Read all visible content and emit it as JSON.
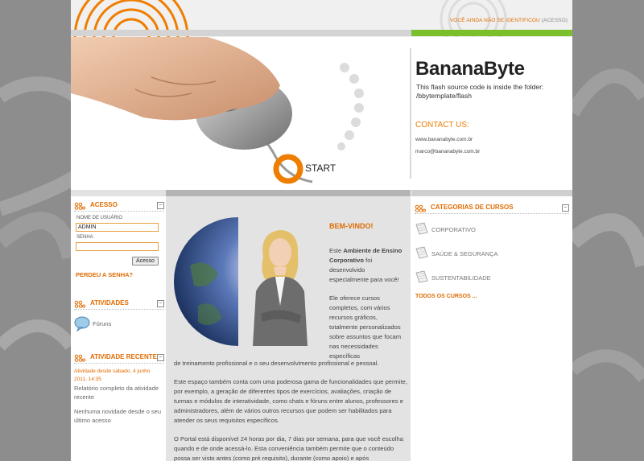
{
  "header": {
    "login_status_text": "VOCÊ AINDA NÃO SE IDENTIFICOU",
    "login_link": "(ACESSO)"
  },
  "banner": {
    "brand": "BananaByte",
    "note_line1": "This flash source code is inside the folder:",
    "note_line2": "/bbytemplate/flash",
    "contact_title": "CONTACT US:",
    "contact_site": "www.bananabyte.com.br",
    "contact_email": "marco@bananabyte.com.br",
    "start_label": "START"
  },
  "access_block": {
    "title": "ACESSO",
    "username_label": "NOME DE USUÁRIO",
    "username_value": "ADMIN",
    "password_label": "SENHA",
    "password_value": "",
    "submit_label": "Acesso",
    "forgot_link": "PERDEU A SENHA?"
  },
  "activities_block": {
    "title": "ATIVIDADES",
    "forums_label": "Fóruns"
  },
  "recent_block": {
    "title": "ATIVIDADE RECENTE",
    "since_text": "Atividade desde sábado, 4 junho 2011, 14:35",
    "full_report_link": "Relatório completo da atividade recente",
    "no_news": "Nenhuma novidade desde o seu último acesso"
  },
  "welcome": {
    "title": "BEM-VINDO!",
    "p1_prefix": "Este ",
    "p1_bold": "Ambiente de Ensino Corporativo",
    "p1_suffix": " foi desenvolvido especialmente para você!",
    "p2_col": "Ele oferece cursos completos, com vários recursos gráficos, totalmente personalizados sobre assuntos que focam nas necessidades específicas",
    "p2_full": "de treinamento profissional e o seu desenvolvimento profissional e pessoal.",
    "p3": "Este espaço também conta com uma poderosa gama de funcionalidades que permite, por exemplo, a geração de diferentes tipos de exercícios, avaliações, criação de turmas e módulos de interatividade, como chats e fóruns entre alunos, professores e administradores, além de vários outros recursos que podem ser habilitados para atender os seus requisitos específicos.",
    "p4": "O Portal está disponível 24 horas por dia, 7 dias por semana, para que você escolha quando e de onde acessá-lo. Esta conveniência também permite que o conteúdo possa ser visto antes (como pré requisito), durante (como apoio) e após"
  },
  "categories_block": {
    "title": "CATEGORIAS DE CURSOS",
    "items": [
      "CORPORATIVO",
      "SAÚDE & SEGURANÇA",
      "SUSTENTABILIDADE"
    ],
    "all_courses": "TODOS OS CURSOS ..."
  },
  "colors": {
    "accent": "#e06b00",
    "green_bar": "#7bbf2a",
    "page_bg": "#8d8d8d",
    "center_bg": "#e3e3e3"
  },
  "icons": [
    "fingerprint-logo-icon",
    "mouse-hand-icon",
    "start-ring-icon",
    "globe-icon",
    "woman-photo-icon",
    "block-dots-icon",
    "collapse-icon",
    "forum-bubble-icon",
    "document-icon"
  ]
}
